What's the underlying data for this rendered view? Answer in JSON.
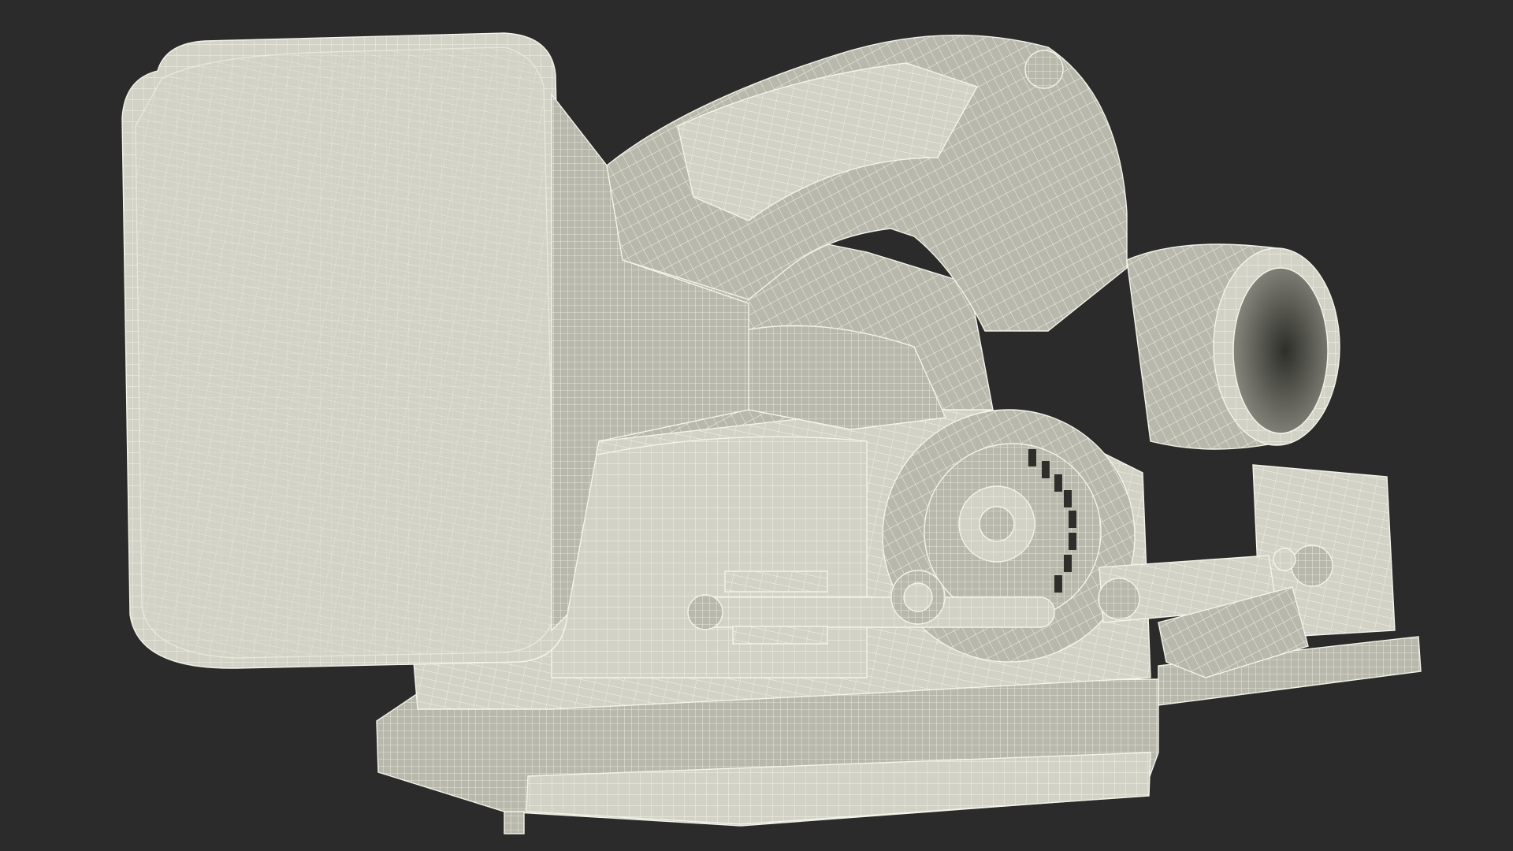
{
  "scene": {
    "subject": "wireframe-planer-model",
    "colors": {
      "background": "#2b2b2b",
      "surface": "#d2d2c6",
      "surface_shade": "#b8b8ac",
      "surface_dark": "#8e8e84",
      "wire": "#f4f4ea",
      "cavity": "#2e2e2a"
    },
    "parts": [
      "battery-pack",
      "handle",
      "motor-housing",
      "fan-cover",
      "dust-port",
      "depth-knob",
      "adjustment-rod",
      "base-plate"
    ]
  }
}
